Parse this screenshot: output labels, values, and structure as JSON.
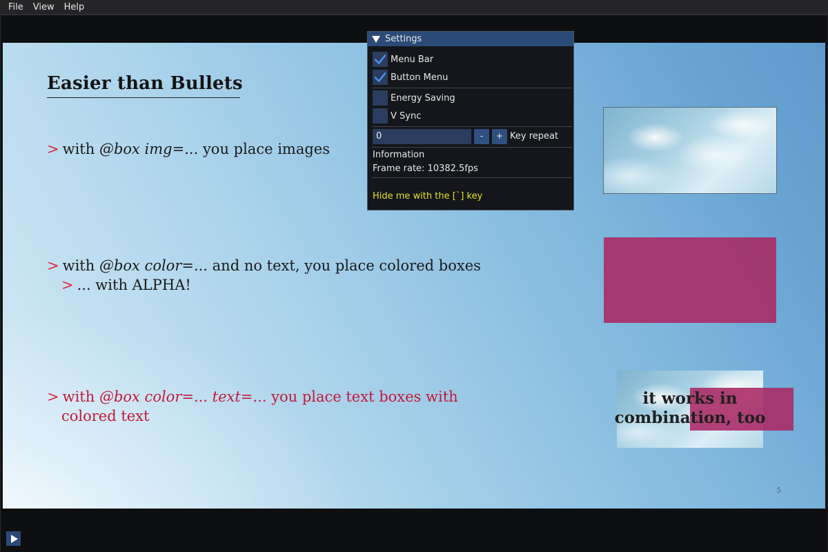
{
  "menubar": {
    "items": [
      "File",
      "View",
      "Help"
    ]
  },
  "slide": {
    "title": "Easier than Bullets",
    "marker": ">",
    "bullet1": {
      "prefix": "with ",
      "code": "@box img=...",
      "suffix": " you place images"
    },
    "bullet2": {
      "prefix": "with ",
      "code": "@box color=...",
      "suffix": " and no text, you place colored boxes"
    },
    "bullet2_sub": "... with ALPHA!",
    "bullet3": {
      "prefix": "with ",
      "code": "@box color=... text=...",
      "suffix": " you place text boxes with",
      "line2": "colored text"
    },
    "combo_line1": "it works in",
    "combo_line2": "combination, too",
    "page_number": "5",
    "colors": {
      "box": "#aa2864",
      "marker": "#e0243a",
      "red_text": "#c2183a"
    }
  },
  "settings": {
    "title": "Settings",
    "menu_bar": "Menu Bar",
    "button_menu": "Button Menu",
    "energy_saving": "Energy Saving",
    "v_sync": "V Sync",
    "key_repeat_value": "0",
    "minus": "-",
    "plus": "+",
    "key_repeat_label": "Key repeat",
    "information": "Information",
    "frame_rate": "Frame rate: 10382.5fps",
    "hint": "Hide me with the [`] key",
    "checked": {
      "menu_bar": true,
      "button_menu": true,
      "energy_saving": false,
      "v_sync": false
    }
  },
  "icons": {
    "collapse": "triangle-down-icon",
    "play": "play-icon",
    "check": "check-icon"
  }
}
